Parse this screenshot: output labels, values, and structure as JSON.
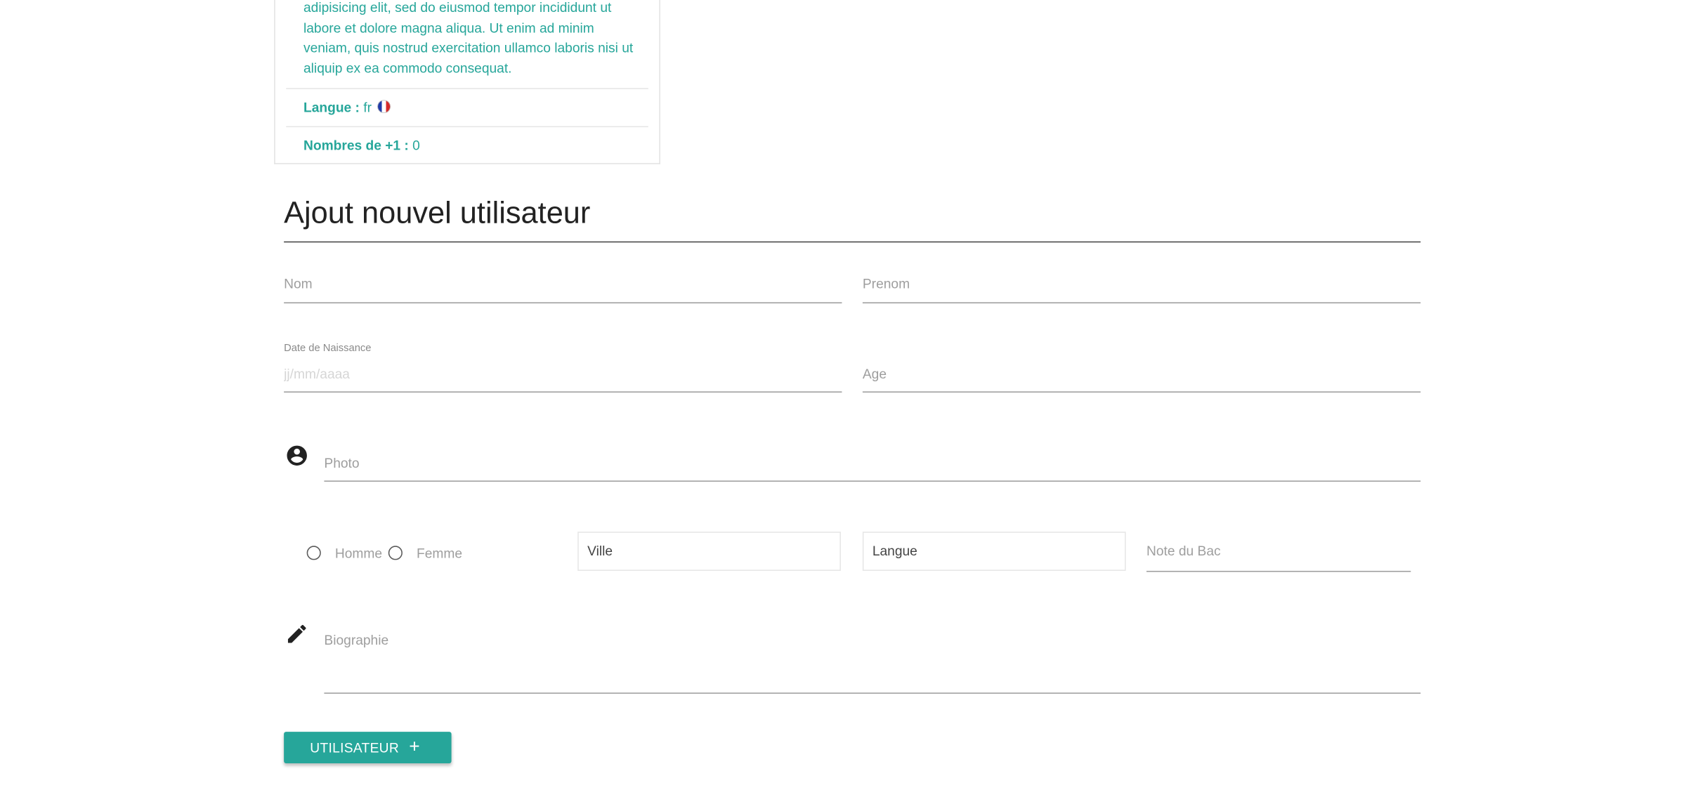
{
  "card": {
    "description": "adipisicing elit, sed do eiusmod tempor incididunt ut labore et dolore magna aliqua. Ut enim ad minim veniam, quis nostrud exercitation ullamco laboris nisi ut aliquip ex ea commodo consequat.",
    "langue_label": "Langue :",
    "langue_value": "fr",
    "flag_icon": "france-flag-icon",
    "plus_label": "Nombres de +1 :",
    "plus_value": "0"
  },
  "form": {
    "title": "Ajout nouvel utilisateur",
    "nom_label": "Nom",
    "prenom_label": "Prenom",
    "date_label": "Date de Naissance",
    "date_placeholder": "jj/mm/aaaa",
    "age_label": "Age",
    "photo_icon": "account-circle-icon",
    "photo_label": "Photo",
    "gender_options": [
      "Homme",
      "Femme"
    ],
    "ville_label": "Ville",
    "langue_label": "Langue",
    "note_label": "Note du Bac",
    "bio_icon": "pencil-icon",
    "bio_label": "Biographie",
    "submit_label": "UTILISATEUR",
    "submit_icon": "+"
  },
  "colors": {
    "accent": "#26a69a",
    "label_grey": "#9e9e9e",
    "title_text": "#222222"
  }
}
